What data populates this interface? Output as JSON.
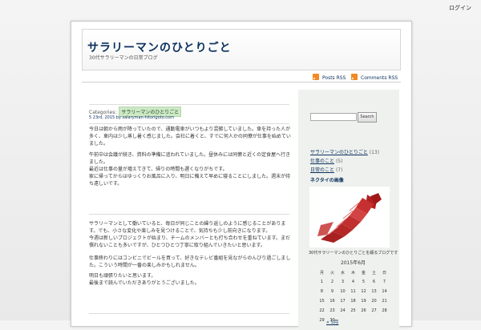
{
  "top_link": "ログイン",
  "header": {
    "site_title": "サラリーマンのひとりごと",
    "site_description": "30代サラリーマンの日常ブログ"
  },
  "rss": {
    "posts": "Posts RSS",
    "comments": "Comments RSS"
  },
  "post": {
    "categories_label": "Categories:",
    "category": "サラリーマンのひとりごと",
    "meta": "5 23rd, 2015 by salaryman-hitorigoto.com"
  },
  "paragraphs": [
    "今日は朝から雨が降っていたので、通勤電車がいつもより混雑していました。傘を持った人が多く、車内は少し蒸し暑く感じました。会社に着くと、すでに何人かの同僚が仕事を始めていました。",
    "午前中は会議が続き、資料の準備に追われていました。昼休みには同僚と近くの定食屋へ行きました。",
    "最近は仕事の量が増えてきて、帰りの時間も遅くなりがちです。",
    "家に帰ってからはゆっくりお風呂に入り、明日に備えて早めに寝ることにしました。週末が待ち遠しいです。",
    "サラリーマンとして働いていると、毎日が同じことの繰り返しのように感じることがあります。でも、小さな変化や楽しみを見つけることで、気持ちも少し前向きになります。",
    "今週は新しいプロジェクトが始まり、チームのメンバーとも打ち合わせを重ねています。まだ慣れないことも多いですが、ひとつひとつ丁寧に取り組んでいきたいと思います。",
    "仕事終わりにはコンビニでビールを買って、好きなテレビ番組を見ながらのんびり過ごしました。こういう時間が一番の楽しみかもしれません。",
    "明日も頑張りたいと思います。",
    "最後まで読んでいただきありがとうございました。"
  ],
  "sidebar": {
    "search_button": "Search",
    "search_value": "",
    "categories": [
      {
        "label": "サラリーマンのひとりごと",
        "count": "(13)"
      },
      {
        "label": "仕事のこと",
        "count": "(5)"
      },
      {
        "label": "日常のこと",
        "count": "(7)"
      }
    ],
    "widget_title": "ネクタイの画像",
    "image_caption": "30代サラリーマンのひとりごとを綴るブログです",
    "calendar": {
      "caption": "2015年6月",
      "headers": [
        "月",
        "火",
        "水",
        "木",
        "金",
        "土",
        "日"
      ],
      "rows": [
        [
          "1",
          "2",
          "3",
          "4",
          "5",
          "6",
          "7"
        ],
        [
          "8",
          "9",
          "10",
          "11",
          "12",
          "13",
          "14"
        ],
        [
          "15",
          "16",
          "17",
          "18",
          "19",
          "20",
          "21"
        ],
        [
          "22",
          "23",
          "24",
          "25",
          "26",
          "27",
          "28"
        ],
        [
          "29",
          "30",
          "",
          "",
          "",
          "",
          ""
        ]
      ],
      "prev_link": "« 5月"
    }
  }
}
